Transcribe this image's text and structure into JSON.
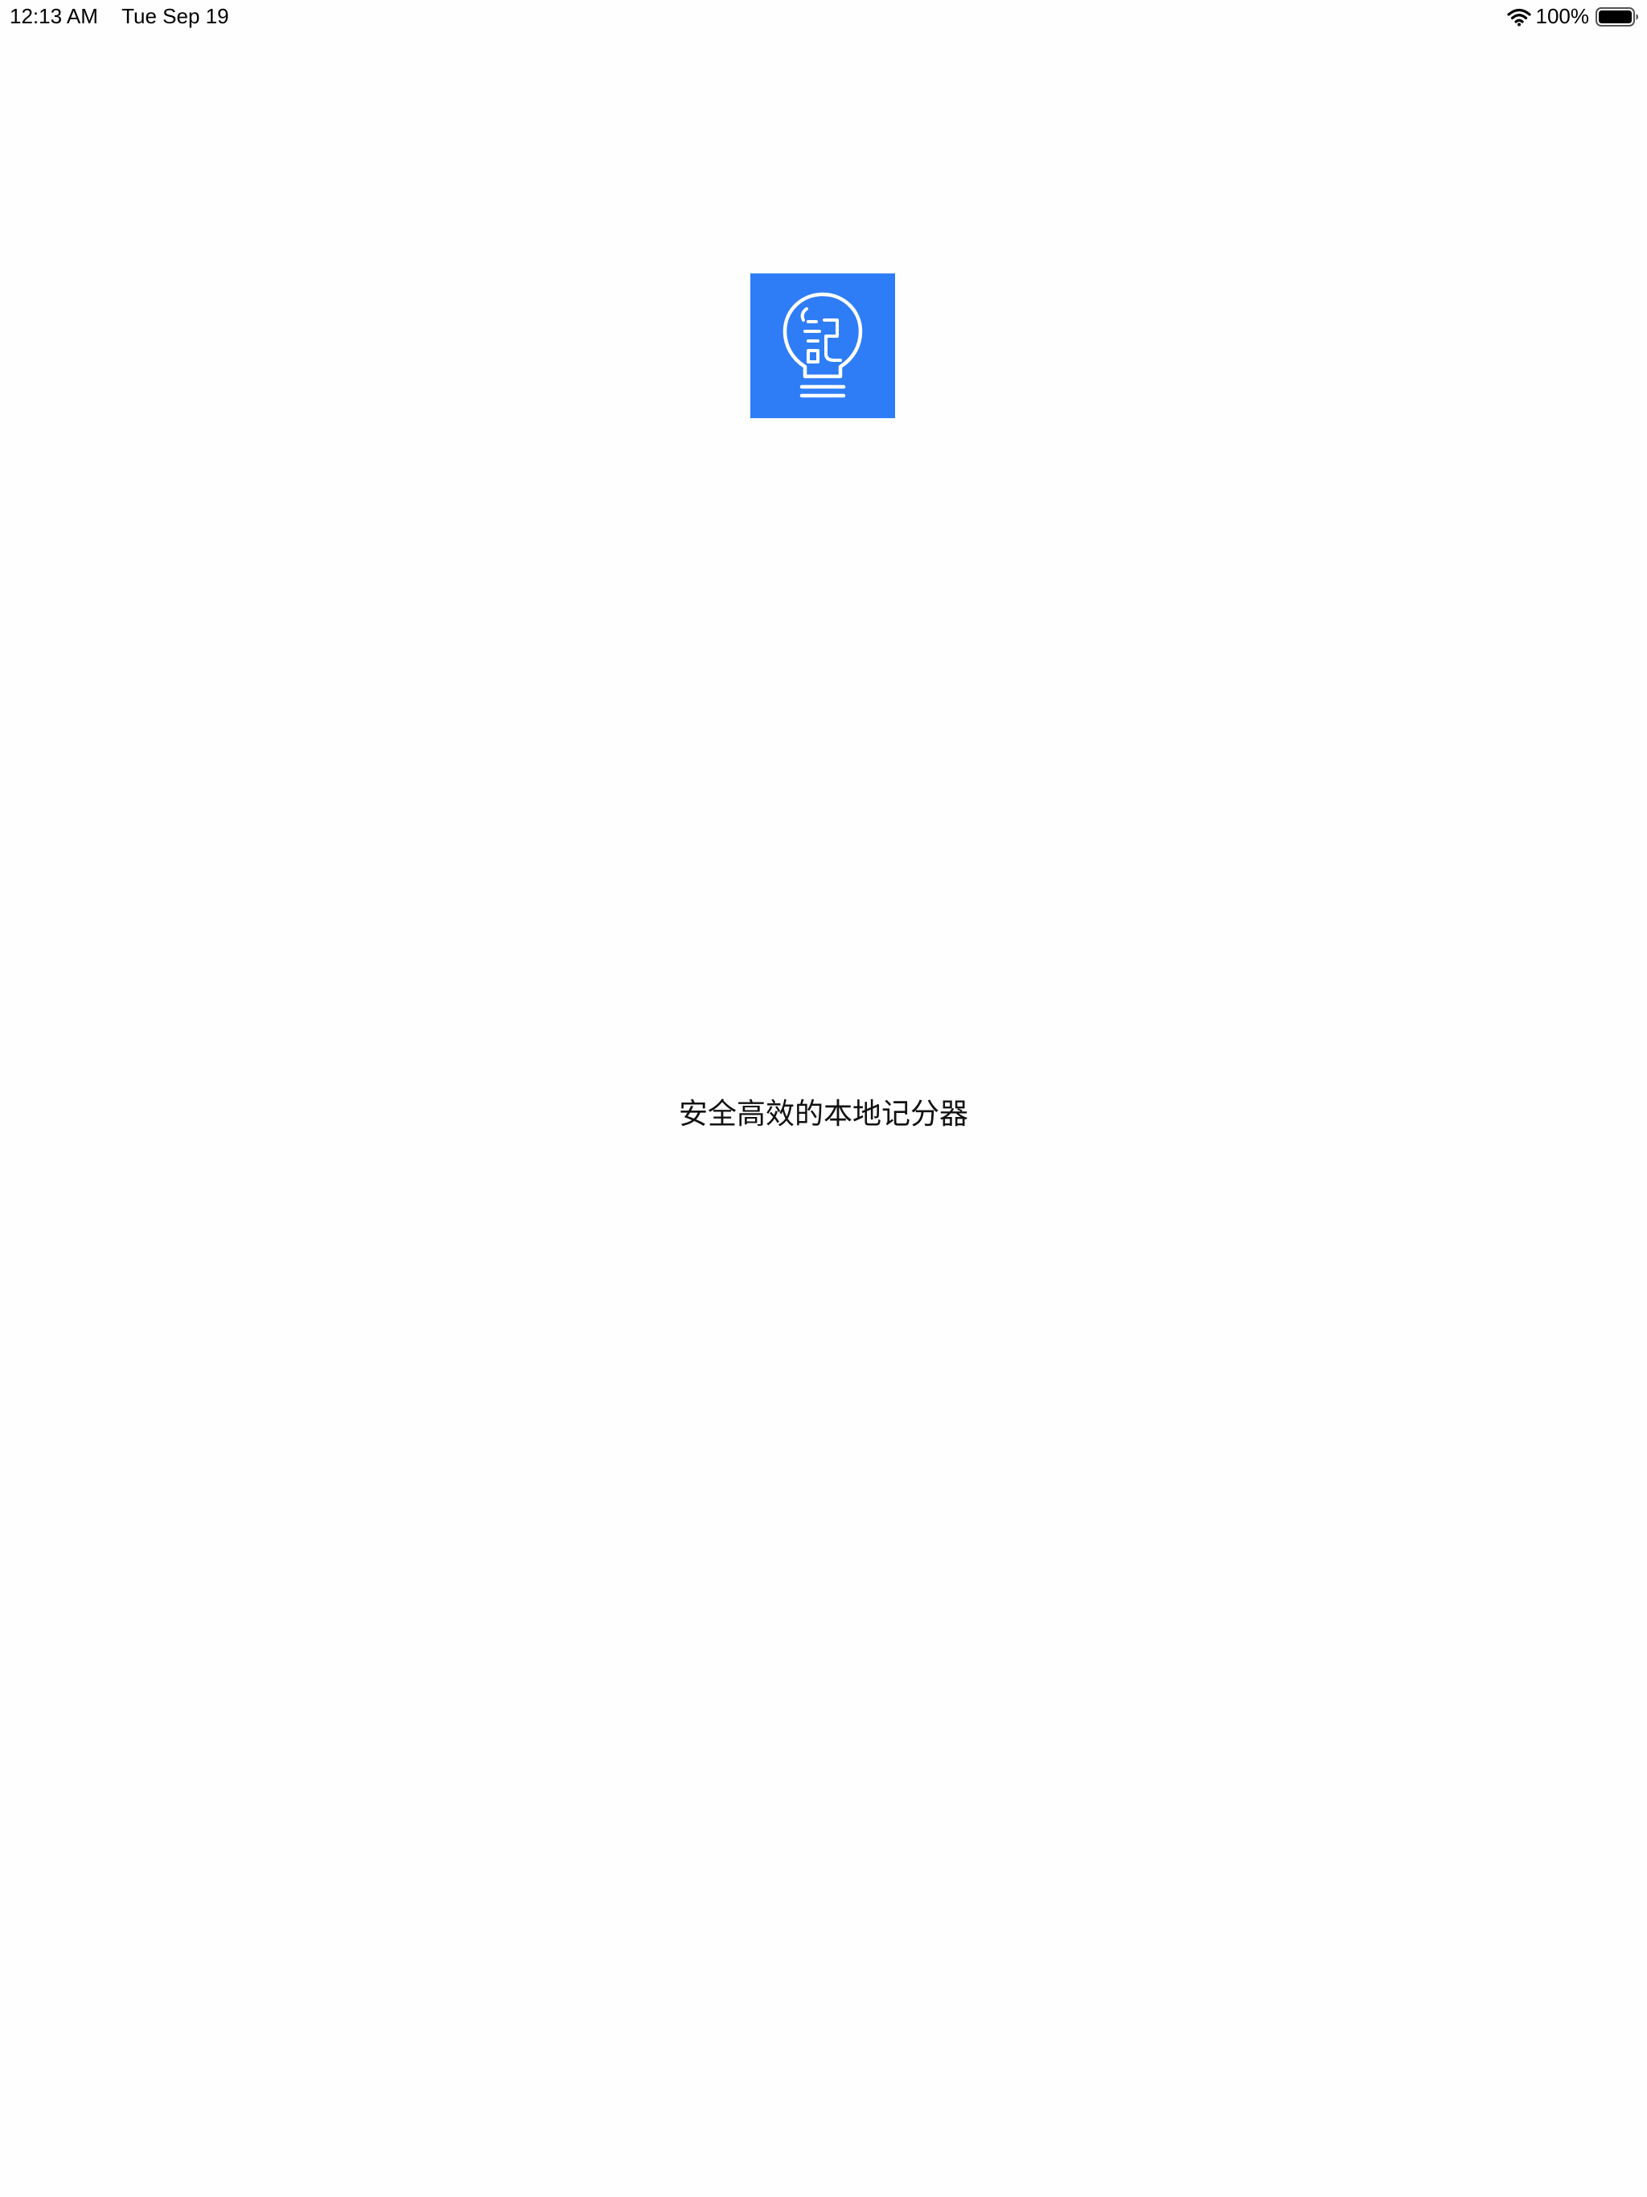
{
  "status_bar": {
    "time": "12:13 AM",
    "date": "Tue Sep 19",
    "wifi_icon": "wifi-icon",
    "battery_percent": "100%",
    "battery_icon": "battery-full-icon"
  },
  "splash": {
    "logo_icon": "lightbulb-note-icon",
    "logo_color": "#2F7DF6",
    "tagline": "安全高效的本地记分器"
  }
}
